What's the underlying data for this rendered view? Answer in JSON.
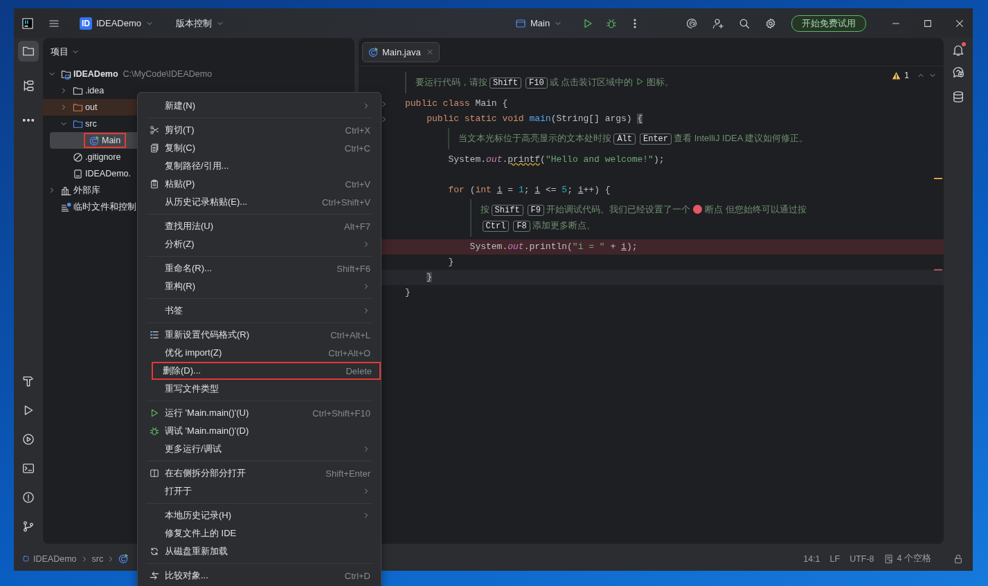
{
  "titlebar": {
    "project_badge": "ID",
    "project": "IDEADemo",
    "vcs": "版本控制",
    "run_config": "Main",
    "trial_button": "开始免费试用"
  },
  "tool_windows": [
    {
      "selected": true
    },
    {
      "selected": false
    },
    {
      "selected": false
    }
  ],
  "project": {
    "title": "项目",
    "tree": [
      {
        "kind": "project",
        "label": "IDEADemo",
        "path": "C:\\MyCode\\IDEADemo",
        "expanded": true,
        "selected": false,
        "outlined": false,
        "children": [
          {
            "kind": "folder",
            "label": ".idea",
            "expanded": false,
            "selected": false,
            "outlined": false
          },
          {
            "kind": "excluded_folder",
            "label": "out",
            "expanded": false,
            "selected": false,
            "outlined": false
          },
          {
            "kind": "source_folder",
            "label": "src",
            "expanded": true,
            "selected": false,
            "outlined": false,
            "children": [
              {
                "kind": "class",
                "label": "Main",
                "selected": true,
                "outlined": true
              }
            ]
          },
          {
            "kind": "ignore_file",
            "label": ".gitignore",
            "selected": false,
            "outlined": false
          },
          {
            "kind": "module_file",
            "label": "IDEADemo.",
            "selected": false,
            "outlined": false
          }
        ]
      },
      {
        "kind": "library",
        "label": "外部库",
        "expanded": false,
        "selected": false,
        "outlined": false
      },
      {
        "kind": "scratches",
        "label": "临时文件和控制",
        "selected": false,
        "outlined": false
      }
    ]
  },
  "editor": {
    "tab": {
      "label": "Main.java",
      "selected": true
    },
    "warnings": "1",
    "lines": [
      {
        "kind": "hint",
        "parts": [
          {
            "kind": "text",
            "text": "要运行代码，请按"
          },
          {
            "kind": "key",
            "text": "Shift"
          },
          {
            "kind": "key",
            "text": "F10"
          },
          {
            "kind": "text",
            "text": "或 点击装订区域中的"
          },
          {
            "kind": "play"
          },
          {
            "kind": "text",
            "text": "图标。"
          }
        ]
      },
      {
        "kind": "code",
        "run_marker": true,
        "tokens": [
          {
            "kind": "kw",
            "text": "public class "
          },
          {
            "kind": "plain",
            "text": "Main {"
          }
        ]
      },
      {
        "kind": "code",
        "run_marker": true,
        "tokens": [
          {
            "kind": "kw",
            "text": "    public static void "
          },
          {
            "kind": "fn",
            "text": "main"
          },
          {
            "kind": "plain",
            "text": "(String[] args) "
          },
          {
            "kind": "brace",
            "text": "{"
          }
        ]
      },
      {
        "kind": "hint",
        "parts": [
          {
            "kind": "text",
            "text": "当文本光标位于高亮显示的文本处时按"
          },
          {
            "kind": "key",
            "text": "Alt"
          },
          {
            "kind": "key",
            "text": "Enter"
          },
          {
            "kind": "text",
            "text": "查看 IntelliJ IDEA 建议如何修正。"
          }
        ]
      },
      {
        "kind": "code",
        "tokens": [
          {
            "kind": "plain",
            "text": "        System."
          },
          {
            "kind": "field",
            "text": "out"
          },
          {
            "kind": "plain",
            "text": "."
          },
          {
            "kind": "warn",
            "text": "printf"
          },
          {
            "kind": "plain",
            "text": "("
          },
          {
            "kind": "str",
            "text": "\"Hello and welcome!\""
          },
          {
            "kind": "plain",
            "text": ");"
          }
        ]
      },
      {
        "kind": "blank"
      },
      {
        "kind": "code",
        "tokens": [
          {
            "kind": "kw",
            "text": "        for "
          },
          {
            "kind": "plain",
            "text": "("
          },
          {
            "kind": "kw",
            "text": "int "
          },
          {
            "kind": "var",
            "text": "i"
          },
          {
            "kind": "plain",
            "text": " = "
          },
          {
            "kind": "num",
            "text": "1"
          },
          {
            "kind": "plain",
            "text": "; "
          },
          {
            "kind": "var",
            "text": "i"
          },
          {
            "kind": "plain",
            "text": " <= "
          },
          {
            "kind": "num",
            "text": "5"
          },
          {
            "kind": "plain",
            "text": "; "
          },
          {
            "kind": "var",
            "text": "i"
          },
          {
            "kind": "plain",
            "text": "++) {"
          }
        ]
      },
      {
        "kind": "hint",
        "parts": [
          {
            "kind": "text",
            "text": "按"
          },
          {
            "kind": "key",
            "text": "Shift"
          },
          {
            "kind": "key",
            "text": "F9"
          },
          {
            "kind": "text",
            "text": "开始调试代码。我们已经设置了一个"
          },
          {
            "kind": "dot"
          },
          {
            "kind": "text",
            "text": "断点 但您始终可以通过按"
          },
          {
            "kind": "break"
          },
          {
            "kind": "key",
            "text": "Ctrl"
          },
          {
            "kind": "key",
            "text": "F8"
          },
          {
            "kind": "text",
            "text": "添加更多断点。"
          }
        ]
      },
      {
        "kind": "code",
        "breakpoint": true,
        "tokens": [
          {
            "kind": "plain",
            "text": "            System."
          },
          {
            "kind": "field",
            "text": "out"
          },
          {
            "kind": "plain",
            "text": ".println("
          },
          {
            "kind": "str",
            "text": "\"i = \""
          },
          {
            "kind": "plain",
            "text": " + "
          },
          {
            "kind": "var",
            "text": "i"
          },
          {
            "kind": "plain",
            "text": ");"
          }
        ]
      },
      {
        "kind": "code",
        "tokens": [
          {
            "kind": "plain",
            "text": "        }"
          }
        ]
      },
      {
        "kind": "code",
        "current": true,
        "tokens": [
          {
            "kind": "brace",
            "text": "    }"
          }
        ]
      },
      {
        "kind": "code",
        "tokens": [
          {
            "kind": "plain",
            "text": "}"
          }
        ]
      }
    ]
  },
  "menu": [
    {
      "kind": "item",
      "label": "新建(N)",
      "submenu": true,
      "outlined": false
    },
    {
      "kind": "separator"
    },
    {
      "kind": "cut",
      "label": "剪切(T)",
      "shortcut": "Ctrl+X",
      "outlined": false
    },
    {
      "kind": "copy",
      "label": "复制(C)",
      "shortcut": "Ctrl+C",
      "outlined": false
    },
    {
      "kind": "item",
      "label": "复制路径/引用...",
      "outlined": false
    },
    {
      "kind": "paste",
      "label": "粘贴(P)",
      "shortcut": "Ctrl+V",
      "outlined": false
    },
    {
      "kind": "item",
      "label": "从历史记录粘贴(E)...",
      "shortcut": "Ctrl+Shift+V",
      "outlined": false
    },
    {
      "kind": "separator"
    },
    {
      "kind": "item",
      "label": "查找用法(U)",
      "shortcut": "Alt+F7",
      "outlined": false
    },
    {
      "kind": "item",
      "label": "分析(Z)",
      "submenu": true,
      "outlined": false
    },
    {
      "kind": "separator"
    },
    {
      "kind": "item",
      "label": "重命名(R)...",
      "shortcut": "Shift+F6",
      "outlined": false
    },
    {
      "kind": "item",
      "label": "重构(R)",
      "submenu": true,
      "outlined": false
    },
    {
      "kind": "separator"
    },
    {
      "kind": "item",
      "label": "书签",
      "submenu": true,
      "outlined": false
    },
    {
      "kind": "separator"
    },
    {
      "kind": "format",
      "label": "重新设置代码格式(R)",
      "shortcut": "Ctrl+Alt+L",
      "outlined": false
    },
    {
      "kind": "item",
      "label": "优化 import(Z)",
      "shortcut": "Ctrl+Alt+O",
      "outlined": false
    },
    {
      "kind": "item",
      "label": "删除(D)...",
      "shortcut": "Delete",
      "outlined": true
    },
    {
      "kind": "item",
      "label": "重写文件类型",
      "outlined": false
    },
    {
      "kind": "separator"
    },
    {
      "kind": "run",
      "label": "运行 'Main.main()'(U)",
      "shortcut": "Ctrl+Shift+F10",
      "outlined": false
    },
    {
      "kind": "debug",
      "label": "调试 'Main.main()'(D)",
      "outlined": false
    },
    {
      "kind": "item",
      "label": "更多运行/调试",
      "submenu": true,
      "outlined": false
    },
    {
      "kind": "separator"
    },
    {
      "kind": "split",
      "label": "在右侧拆分部分打开",
      "shortcut": "Shift+Enter",
      "outlined": false
    },
    {
      "kind": "item",
      "label": "打开于",
      "submenu": true,
      "outlined": false
    },
    {
      "kind": "separator"
    },
    {
      "kind": "item",
      "label": "本地历史记录(H)",
      "submenu": true,
      "outlined": false
    },
    {
      "kind": "item",
      "label": "修复文件上的 IDE",
      "outlined": false
    },
    {
      "kind": "reload",
      "label": "从磁盘重新加载",
      "outlined": false
    },
    {
      "kind": "separator"
    },
    {
      "kind": "compare",
      "label": "比较对象...",
      "shortcut": "Ctrl+D",
      "outlined": false
    }
  ],
  "status_bar": {
    "breadcrumbs": [
      "IDEADemo",
      "src"
    ],
    "position": "14:1",
    "line_ending": "LF",
    "encoding": "UTF-8",
    "indent": "4 个空格"
  }
}
